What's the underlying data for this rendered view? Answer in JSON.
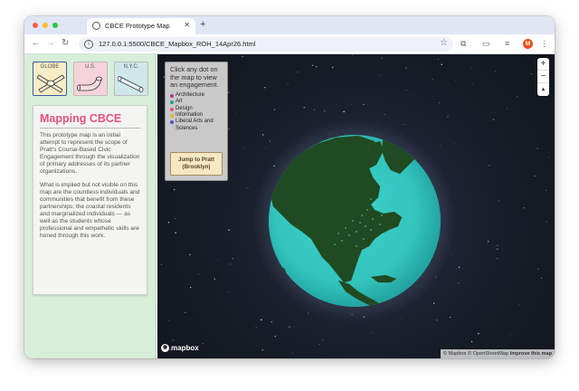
{
  "browser": {
    "tab_title": "CBCE Prototype Map",
    "new_tab_symbol": "+",
    "url": "127.0.0.1:5500/CBCE_Mapbox_ROH_14Apr26.html",
    "avatar_letter": "M",
    "icons": [
      "back-arrow-icon",
      "forward-arrow-icon",
      "reload-icon",
      "site-info-icon",
      "bookmark-star-icon",
      "extensions-icon",
      "tab-search-icon",
      "media-control-icon",
      "menu-icon"
    ]
  },
  "sidebar": {
    "buttons": [
      {
        "label": "GLOBE",
        "color": "#f6edc6",
        "border": "#3d5aa0"
      },
      {
        "label": "U.S.",
        "color": "#f6d3da",
        "border": "#bdbdbd"
      },
      {
        "label": "N.Y.C.",
        "color": "#cfe6ea",
        "border": "#bdbdbd"
      }
    ],
    "card": {
      "title": "Mapping CBCE",
      "paragraphs": [
        "This prototype map is an initial attempt to represent the scope of Pratt's Course-Based Civic Engagement through the visualization of primary addresses of its partner organizations.",
        "What is implied but not visible on this map are the countless individuals and communities that benefit from these partnerships; the coastal residents and marginalized individuals — as well as the students whose professional and empathetic skills are honed through this work."
      ]
    }
  },
  "map": {
    "legend_intro": "Click any dot on the map to view an engagement.",
    "categories": [
      {
        "label": "Architecture",
        "color": "#b5338a"
      },
      {
        "label": "Art",
        "color": "#2a9d9d"
      },
      {
        "label": "Design",
        "color": "#e8507f"
      },
      {
        "label": "Information",
        "color": "#e0b030"
      },
      {
        "label": "Liberal Arts and Sciences",
        "color": "#4f53c8"
      }
    ],
    "jump_button": "Jump to Pratt (Brooklyn)",
    "zoom_in": "+",
    "zoom_out": "−",
    "compass": "▲",
    "logo_text": "mapbox",
    "attribution": {
      "copyright": "© Mapbox © OpenStreetMap",
      "improve": "Improve this map"
    },
    "colors": {
      "ocean": "#34c7c2",
      "land": "#1f4a22",
      "space": "#161b26"
    }
  }
}
